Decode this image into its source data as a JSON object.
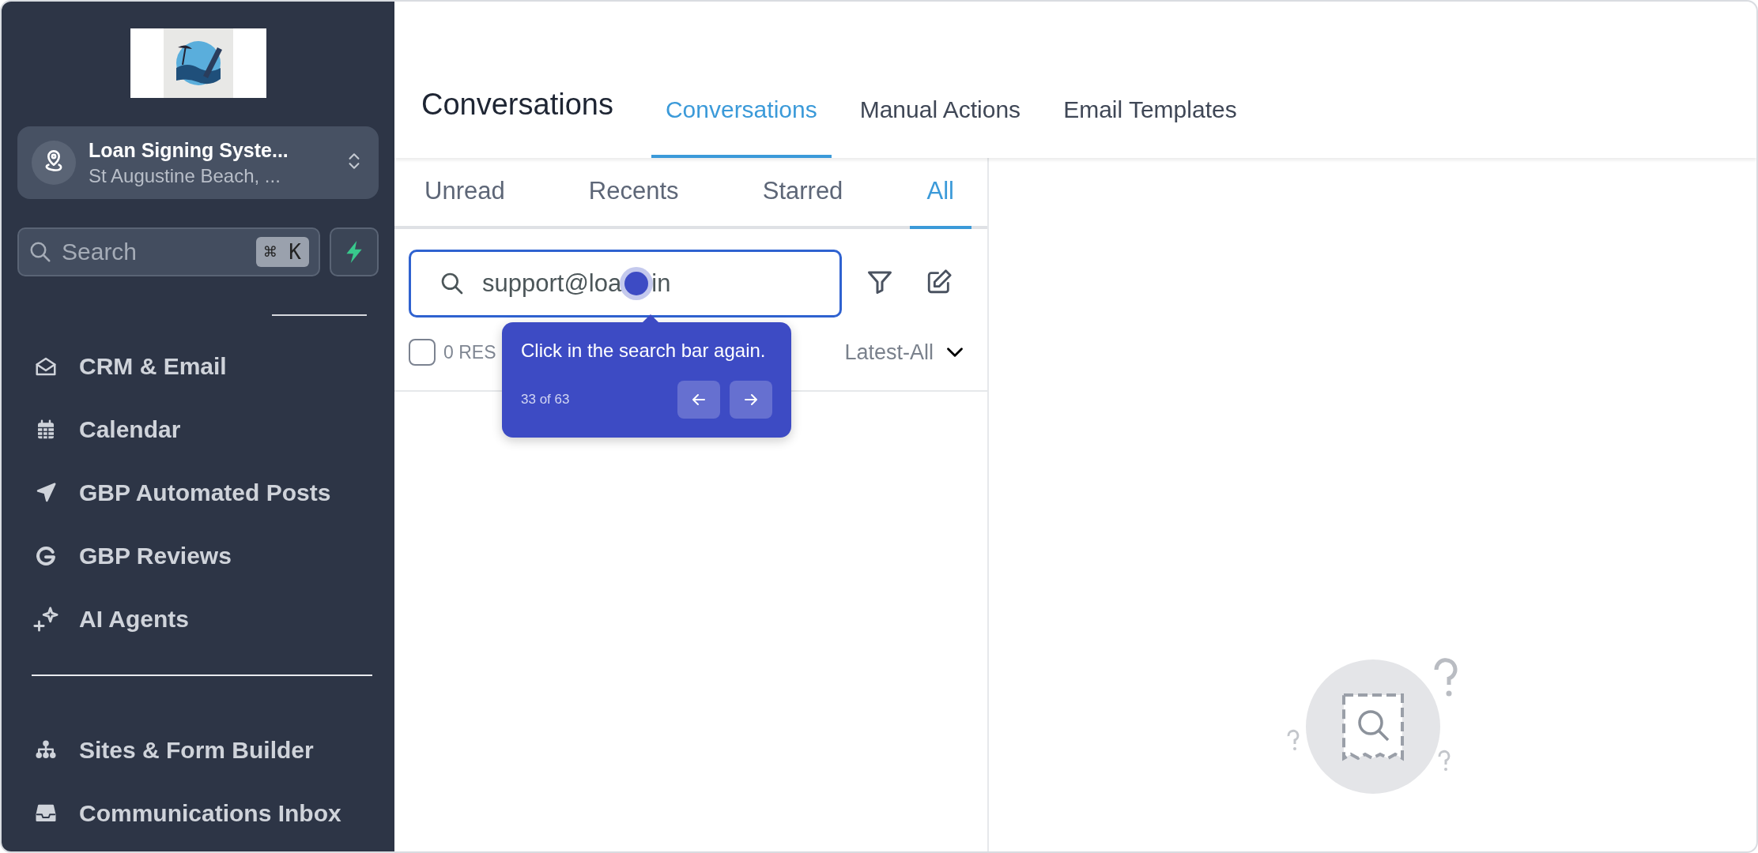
{
  "sidebar": {
    "account": {
      "name": "Loan Signing Syste...",
      "location": "St Augustine Beach, ..."
    },
    "search": {
      "placeholder": "Search",
      "shortcut": "⌘ K"
    },
    "groups": [
      {
        "items": [
          {
            "label": "CRM & Email"
          },
          {
            "label": "Calendar"
          },
          {
            "label": "GBP Automated Posts"
          },
          {
            "label": "GBP Reviews"
          },
          {
            "label": "AI Agents"
          }
        ]
      },
      {
        "items": [
          {
            "label": "Sites & Form Builder"
          },
          {
            "label": "Communications Inbox"
          }
        ]
      }
    ]
  },
  "header": {
    "title": "Conversations",
    "tabs": [
      {
        "label": "Conversations",
        "selected": true
      },
      {
        "label": "Manual Actions",
        "selected": false
      },
      {
        "label": "Email Templates",
        "selected": false
      }
    ]
  },
  "filter_tabs": [
    {
      "label": "Unread",
      "selected": false
    },
    {
      "label": "Recents",
      "selected": false
    },
    {
      "label": "Starred",
      "selected": false
    },
    {
      "label": "All",
      "selected": true
    }
  ],
  "search": {
    "value": "support@loa",
    "value_after_cursor": "in"
  },
  "list": {
    "select_all": {
      "checked": false
    },
    "results": "0 RES",
    "sort": "Latest-All"
  },
  "tooltip": {
    "text": "Click in the search bar again.",
    "progress": "33 of 63"
  }
}
